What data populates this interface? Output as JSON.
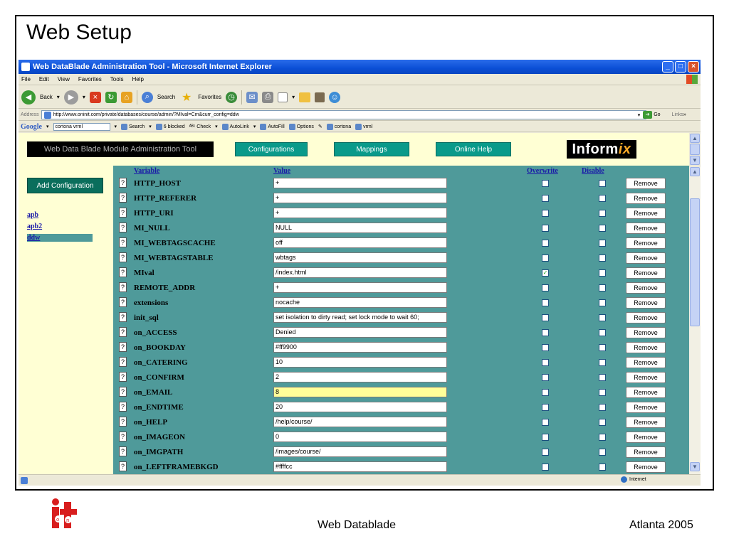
{
  "slide": {
    "title": "Web Setup",
    "footer_center": "Web Datablade",
    "footer_right": "Atlanta 2005"
  },
  "browser": {
    "window_title": "Web DataBlade Administration Tool - Microsoft Internet Explorer",
    "menu": [
      "File",
      "Edit",
      "View",
      "Favorites",
      "Tools",
      "Help"
    ],
    "toolbar": {
      "back": "Back",
      "search": "Search",
      "favorites": "Favorites"
    },
    "address_label": "Address",
    "address_url": "http://www.oninit.com/private/databases/course/admin/?MIval=Cm&curr_config=ddw",
    "go_label": "Go",
    "links_label": "Links",
    "google": {
      "logo": "Google",
      "query": "cortona vrml",
      "search": "Search",
      "blocked": "6 blocked",
      "check": "Check",
      "autolink": "AutoLink",
      "autofill": "AutoFill",
      "options": "Options",
      "term1": "cortona",
      "term2": "vrml"
    },
    "status_zone": "Internet"
  },
  "app": {
    "header_title": "Web Data Blade Module Administration Tool",
    "nav": {
      "configurations": "Configurations",
      "mappings": "Mappings",
      "online_help": "Online Help"
    },
    "logo_prefix": "Inform",
    "logo_suffix": "ix",
    "add_configuration": "Add Configuration",
    "configs": [
      "apb",
      "apb2",
      "ddw"
    ],
    "selected_config": "ddw",
    "columns": {
      "variable": "Variable",
      "value": "Value",
      "overwrite": "Overwrite",
      "disable": "Disable"
    },
    "help_glyph": "?",
    "remove_label": "Remove",
    "rows": [
      {
        "variable": "HTTP_HOST",
        "value": "+",
        "overwrite": false,
        "disable": false
      },
      {
        "variable": "HTTP_REFERER",
        "value": "+",
        "overwrite": false,
        "disable": false
      },
      {
        "variable": "HTTP_URI",
        "value": "+",
        "overwrite": false,
        "disable": false
      },
      {
        "variable": "MI_NULL",
        "value": "NULL",
        "overwrite": false,
        "disable": false
      },
      {
        "variable": "MI_WEBTAGSCACHE",
        "value": "off",
        "overwrite": false,
        "disable": false
      },
      {
        "variable": "MI_WEBTAGSTABLE",
        "value": "wbtags",
        "overwrite": false,
        "disable": false
      },
      {
        "variable": "MIval",
        "value": "/index.html",
        "overwrite": true,
        "disable": false
      },
      {
        "variable": "REMOTE_ADDR",
        "value": "+",
        "overwrite": false,
        "disable": false
      },
      {
        "variable": "extensions",
        "value": "nocache",
        "overwrite": false,
        "disable": false
      },
      {
        "variable": "init_sql",
        "value": "set isolation to dirty read; set lock mode to wait 60;",
        "overwrite": false,
        "disable": false
      },
      {
        "variable": "on_ACCESS",
        "value": "Denied",
        "overwrite": false,
        "disable": false
      },
      {
        "variable": "on_BOOKDAY",
        "value": "#ff9900",
        "overwrite": false,
        "disable": false
      },
      {
        "variable": "on_CATERING",
        "value": "10",
        "overwrite": false,
        "disable": false
      },
      {
        "variable": "on_CONFIRM",
        "value": "2",
        "overwrite": false,
        "disable": false
      },
      {
        "variable": "on_EMAIL",
        "value": "8",
        "overwrite": false,
        "disable": false,
        "highlight": true
      },
      {
        "variable": "on_ENDTIME",
        "value": "20",
        "overwrite": false,
        "disable": false
      },
      {
        "variable": "on_HELP",
        "value": "/help/course/",
        "overwrite": false,
        "disable": false
      },
      {
        "variable": "on_IMAGEON",
        "value": "0",
        "overwrite": false,
        "disable": false
      },
      {
        "variable": "on_IMGPATH",
        "value": "/images/course/",
        "overwrite": false,
        "disable": false
      },
      {
        "variable": "on_LEFTFRAMEBKGD",
        "value": "#ffffcc",
        "overwrite": false,
        "disable": false
      }
    ]
  },
  "colors": {
    "teal_bg": "#4f9a9a",
    "cream_bg": "#ffffd4",
    "nav_button": "#0a9a8a",
    "link_blue": "#1a1aa8",
    "highlight": "#ffff99"
  }
}
